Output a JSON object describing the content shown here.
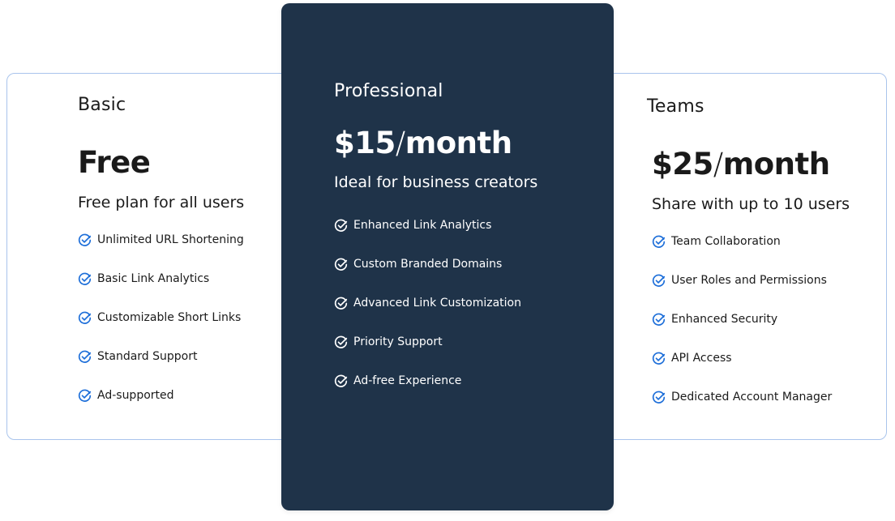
{
  "colors": {
    "accent": "#1e6fd9",
    "card_border": "#a9c4ec",
    "featured_bg": "#1f3349",
    "text_dark": "#1a1a1a",
    "text_light": "#ffffff"
  },
  "plans": [
    {
      "name": "Basic",
      "price": "Free",
      "price_unit": "",
      "description": "Free plan for all users",
      "features": [
        "Unlimited URL Shortening",
        "Basic Link Analytics",
        "Customizable Short Links",
        "Standard Support",
        "Ad-supported"
      ]
    },
    {
      "name": "Professional",
      "price": "$15",
      "price_unit": "month",
      "description": "Ideal for business creators",
      "features": [
        "Enhanced Link Analytics",
        "Custom Branded Domains",
        "Advanced Link Customization",
        "Priority Support",
        "Ad-free Experience"
      ]
    },
    {
      "name": "Teams",
      "price": "$25",
      "price_unit": "month",
      "description": "Share with up to 10 users",
      "features": [
        "Team Collaboration",
        "User Roles and Permissions",
        "Enhanced Security",
        "API Access",
        "Dedicated Account Manager"
      ]
    }
  ],
  "icons": {
    "feature_check": "check-circle-icon"
  }
}
